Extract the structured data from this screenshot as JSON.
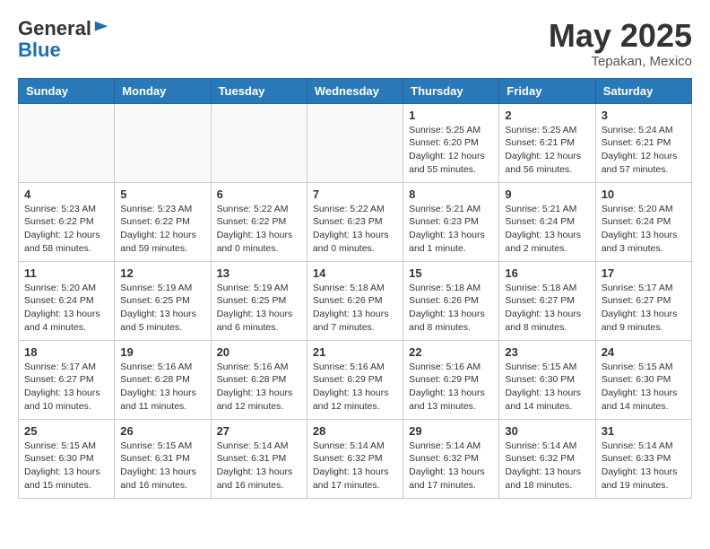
{
  "header": {
    "logo_general": "General",
    "logo_blue": "Blue",
    "month_title": "May 2025",
    "location": "Tepakan, Mexico"
  },
  "calendar": {
    "days_of_week": [
      "Sunday",
      "Monday",
      "Tuesday",
      "Wednesday",
      "Thursday",
      "Friday",
      "Saturday"
    ],
    "weeks": [
      [
        {
          "day": "",
          "info": ""
        },
        {
          "day": "",
          "info": ""
        },
        {
          "day": "",
          "info": ""
        },
        {
          "day": "",
          "info": ""
        },
        {
          "day": "1",
          "info": "Sunrise: 5:25 AM\nSunset: 6:20 PM\nDaylight: 12 hours and 55 minutes."
        },
        {
          "day": "2",
          "info": "Sunrise: 5:25 AM\nSunset: 6:21 PM\nDaylight: 12 hours and 56 minutes."
        },
        {
          "day": "3",
          "info": "Sunrise: 5:24 AM\nSunset: 6:21 PM\nDaylight: 12 hours and 57 minutes."
        }
      ],
      [
        {
          "day": "4",
          "info": "Sunrise: 5:23 AM\nSunset: 6:22 PM\nDaylight: 12 hours and 58 minutes."
        },
        {
          "day": "5",
          "info": "Sunrise: 5:23 AM\nSunset: 6:22 PM\nDaylight: 12 hours and 59 minutes."
        },
        {
          "day": "6",
          "info": "Sunrise: 5:22 AM\nSunset: 6:22 PM\nDaylight: 13 hours and 0 minutes."
        },
        {
          "day": "7",
          "info": "Sunrise: 5:22 AM\nSunset: 6:23 PM\nDaylight: 13 hours and 0 minutes."
        },
        {
          "day": "8",
          "info": "Sunrise: 5:21 AM\nSunset: 6:23 PM\nDaylight: 13 hours and 1 minute."
        },
        {
          "day": "9",
          "info": "Sunrise: 5:21 AM\nSunset: 6:24 PM\nDaylight: 13 hours and 2 minutes."
        },
        {
          "day": "10",
          "info": "Sunrise: 5:20 AM\nSunset: 6:24 PM\nDaylight: 13 hours and 3 minutes."
        }
      ],
      [
        {
          "day": "11",
          "info": "Sunrise: 5:20 AM\nSunset: 6:24 PM\nDaylight: 13 hours and 4 minutes."
        },
        {
          "day": "12",
          "info": "Sunrise: 5:19 AM\nSunset: 6:25 PM\nDaylight: 13 hours and 5 minutes."
        },
        {
          "day": "13",
          "info": "Sunrise: 5:19 AM\nSunset: 6:25 PM\nDaylight: 13 hours and 6 minutes."
        },
        {
          "day": "14",
          "info": "Sunrise: 5:18 AM\nSunset: 6:26 PM\nDaylight: 13 hours and 7 minutes."
        },
        {
          "day": "15",
          "info": "Sunrise: 5:18 AM\nSunset: 6:26 PM\nDaylight: 13 hours and 8 minutes."
        },
        {
          "day": "16",
          "info": "Sunrise: 5:18 AM\nSunset: 6:27 PM\nDaylight: 13 hours and 8 minutes."
        },
        {
          "day": "17",
          "info": "Sunrise: 5:17 AM\nSunset: 6:27 PM\nDaylight: 13 hours and 9 minutes."
        }
      ],
      [
        {
          "day": "18",
          "info": "Sunrise: 5:17 AM\nSunset: 6:27 PM\nDaylight: 13 hours and 10 minutes."
        },
        {
          "day": "19",
          "info": "Sunrise: 5:16 AM\nSunset: 6:28 PM\nDaylight: 13 hours and 11 minutes."
        },
        {
          "day": "20",
          "info": "Sunrise: 5:16 AM\nSunset: 6:28 PM\nDaylight: 13 hours and 12 minutes."
        },
        {
          "day": "21",
          "info": "Sunrise: 5:16 AM\nSunset: 6:29 PM\nDaylight: 13 hours and 12 minutes."
        },
        {
          "day": "22",
          "info": "Sunrise: 5:16 AM\nSunset: 6:29 PM\nDaylight: 13 hours and 13 minutes."
        },
        {
          "day": "23",
          "info": "Sunrise: 5:15 AM\nSunset: 6:30 PM\nDaylight: 13 hours and 14 minutes."
        },
        {
          "day": "24",
          "info": "Sunrise: 5:15 AM\nSunset: 6:30 PM\nDaylight: 13 hours and 14 minutes."
        }
      ],
      [
        {
          "day": "25",
          "info": "Sunrise: 5:15 AM\nSunset: 6:30 PM\nDaylight: 13 hours and 15 minutes."
        },
        {
          "day": "26",
          "info": "Sunrise: 5:15 AM\nSunset: 6:31 PM\nDaylight: 13 hours and 16 minutes."
        },
        {
          "day": "27",
          "info": "Sunrise: 5:14 AM\nSunset: 6:31 PM\nDaylight: 13 hours and 16 minutes."
        },
        {
          "day": "28",
          "info": "Sunrise: 5:14 AM\nSunset: 6:32 PM\nDaylight: 13 hours and 17 minutes."
        },
        {
          "day": "29",
          "info": "Sunrise: 5:14 AM\nSunset: 6:32 PM\nDaylight: 13 hours and 17 minutes."
        },
        {
          "day": "30",
          "info": "Sunrise: 5:14 AM\nSunset: 6:32 PM\nDaylight: 13 hours and 18 minutes."
        },
        {
          "day": "31",
          "info": "Sunrise: 5:14 AM\nSunset: 6:33 PM\nDaylight: 13 hours and 19 minutes."
        }
      ]
    ]
  }
}
